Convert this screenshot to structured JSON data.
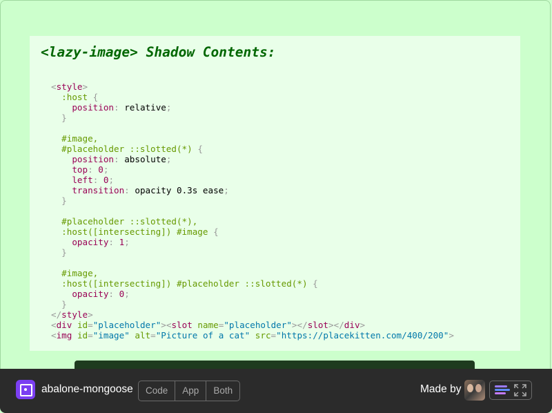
{
  "heading": "<lazy-image> Shadow Contents:",
  "code_lines": [
    "<style>",
    "  :host {",
    "    position: relative;",
    "  }",
    "",
    "  #image,",
    "  #placeholder ::slotted(*) {",
    "    position: absolute;",
    "    top: 0;",
    "    left: 0;",
    "    transition: opacity 0.3s ease;",
    "  }",
    "",
    "  #placeholder ::slotted(*),",
    "  :host([intersecting]) #image {",
    "    opacity: 1;",
    "  }",
    "",
    "  #image,",
    "  :host([intersecting]) #placeholder ::slotted(*) {",
    "    opacity: 0;",
    "  }",
    "</style>",
    "<div id=\"placeholder\"><slot name=\"placeholder\"></slot></div>",
    "<img id=\"image\" alt=\"Picture of a cat\" src=\"https://placekitten.com/400/200\">"
  ],
  "footer": {
    "project_name": "abalone-mongoose",
    "view_tabs": [
      "Code",
      "App",
      "Both"
    ],
    "made_by": "Made by"
  },
  "icons": {
    "logo": "glitch-project-icon",
    "avatar": "user-avatar",
    "fish": "glitch-fish-icon",
    "expand": "fullscreen-icon"
  },
  "colors": {
    "background": "#ccffcc",
    "panel": "#e9ffe9",
    "heading": "#006600",
    "footer": "#2b2b2b",
    "accent": "#7b3ff2"
  }
}
